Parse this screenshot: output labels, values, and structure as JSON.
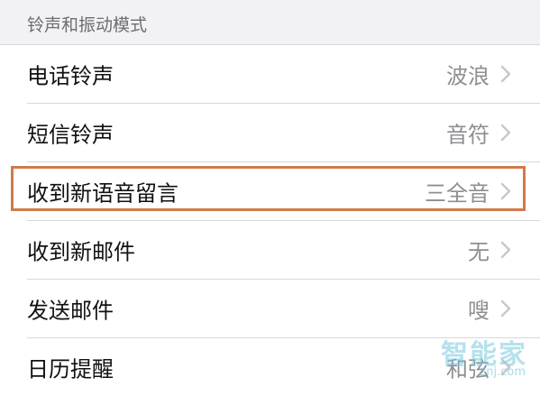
{
  "section": {
    "title": "铃声和振动模式"
  },
  "rows": [
    {
      "label": "电话铃声",
      "value": "波浪",
      "icon": "chevron-right-icon"
    },
    {
      "label": "短信铃声",
      "value": "音符",
      "icon": "chevron-right-icon"
    },
    {
      "label": "收到新语音留言",
      "value": "三全音",
      "icon": "chevron-right-icon",
      "highlighted": true
    },
    {
      "label": "收到新邮件",
      "value": "无",
      "icon": "chevron-right-icon"
    },
    {
      "label": "发送邮件",
      "value": "嗖",
      "icon": "chevron-right-icon"
    },
    {
      "label": "日历提醒",
      "value": "和弦",
      "icon": "chevron-right-icon"
    }
  ],
  "watermark": {
    "brand": "智能家",
    "url": "znj.com"
  },
  "colors": {
    "highlight": "#d17a4a",
    "value_text": "#8e8e93",
    "chevron": "#c7c7cc",
    "background": "#f2f2f4"
  }
}
